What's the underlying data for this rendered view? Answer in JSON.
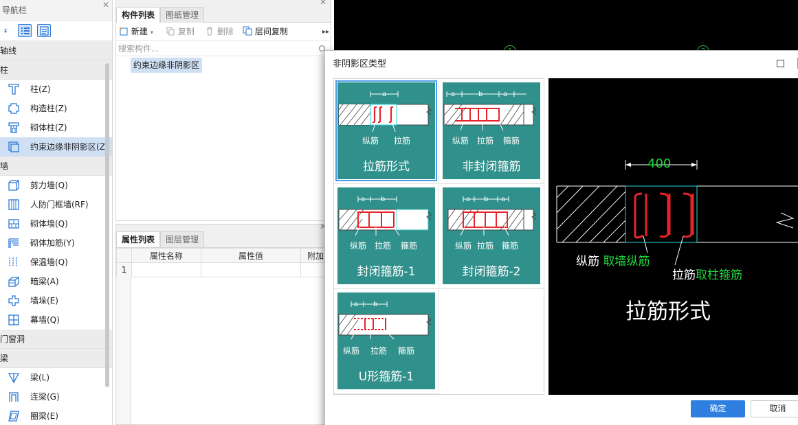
{
  "nav": {
    "title": "导航栏",
    "groups": [
      {
        "label": "轴线"
      },
      {
        "label": "柱",
        "items": [
          {
            "label": "柱(Z)"
          },
          {
            "label": "构造柱(Z)"
          },
          {
            "label": "砌体柱(Z)"
          },
          {
            "label": "约束边缘非阴影区(Z"
          }
        ]
      },
      {
        "label": "墙",
        "items": [
          {
            "label": "剪力墙(Q)"
          },
          {
            "label": "人防门框墙(RF)"
          },
          {
            "label": "砌体墙(Q)"
          },
          {
            "label": "砌体加筋(Y)"
          },
          {
            "label": "保温墙(Q)"
          },
          {
            "label": "暗梁(A)"
          },
          {
            "label": "墙垛(E)"
          },
          {
            "label": "幕墙(Q)"
          }
        ]
      },
      {
        "label": "门窗洞"
      },
      {
        "label": "梁",
        "items": [
          {
            "label": "梁(L)"
          },
          {
            "label": "连梁(G)"
          },
          {
            "label": "圈梁(E)"
          }
        ]
      }
    ]
  },
  "comp_panel": {
    "tabs": [
      "构件列表",
      "图纸管理"
    ],
    "toolbar": {
      "new": "新建",
      "copy": "复制",
      "delete": "删除",
      "floor_copy": "层间复制"
    },
    "search_placeholder": "搜索构件...",
    "items": [
      "约束边缘非阴影区"
    ]
  },
  "prop_panel": {
    "tabs": [
      "属性列表",
      "图层管理"
    ],
    "columns": [
      "属性名称",
      "属性值",
      "附加"
    ],
    "rows": [
      {
        "index": "1",
        "name": "",
        "value": "",
        "extra": ""
      }
    ]
  },
  "cad": {
    "axis_labels": [
      "1",
      "2"
    ]
  },
  "dialog": {
    "title": "非阴影区类型",
    "options": [
      {
        "name": "拉筋形式",
        "labels": [
          "纵筋",
          "拉筋"
        ],
        "dims": [
          "a"
        ],
        "selected": true
      },
      {
        "name": "非封闭箍筋",
        "labels": [
          "纵筋",
          "拉筋",
          "箍筋"
        ],
        "dims": [
          "a",
          "b",
          "a"
        ]
      },
      {
        "name": "封闭箍筋-1",
        "labels": [
          "纵筋",
          "拉筋",
          "箍筋"
        ],
        "dims": [
          "a",
          "b"
        ]
      },
      {
        "name": "封闭箍筋-2",
        "labels": [
          "纵筋",
          "拉筋",
          "箍筋"
        ],
        "dims": [
          "a",
          "b",
          "a"
        ]
      },
      {
        "name": "U形箍筋-1",
        "labels": [
          "纵筋",
          "拉筋",
          "箍筋"
        ],
        "dims": [
          "a",
          "b"
        ]
      }
    ],
    "preview": {
      "title": "拉筋形式",
      "dimension": "400",
      "label1_white": "纵筋",
      "label1_green": "取墙纵筋",
      "label2_white": "拉筋",
      "label2_green": "取柱箍筋"
    },
    "ok": "确定",
    "cancel": "取消"
  },
  "colors": {
    "card": "#30908b",
    "rebar": "#e8242a",
    "dim_green": "#21d93f",
    "ok_button": "#2e7fe0"
  }
}
